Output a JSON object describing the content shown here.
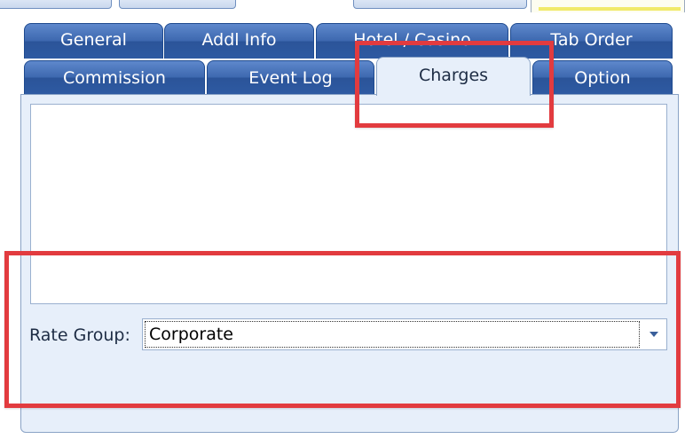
{
  "tabs": {
    "row_back": [
      {
        "label": "General"
      },
      {
        "label": "Addl Info"
      },
      {
        "label": "Hotel / Casino"
      },
      {
        "label": "Tab Order"
      }
    ],
    "row_front": [
      {
        "label": "Commission"
      },
      {
        "label": "Event Log"
      },
      {
        "label": "Charges"
      },
      {
        "label": "Option"
      }
    ],
    "active": "Charges"
  },
  "charges": {
    "rate_group_label": "Rate Group:",
    "rate_group_value": "Corporate"
  },
  "colors": {
    "tab_blue": "#2e5aa2",
    "panel_bg": "#e7effa",
    "highlight_red": "#e23b3f"
  }
}
